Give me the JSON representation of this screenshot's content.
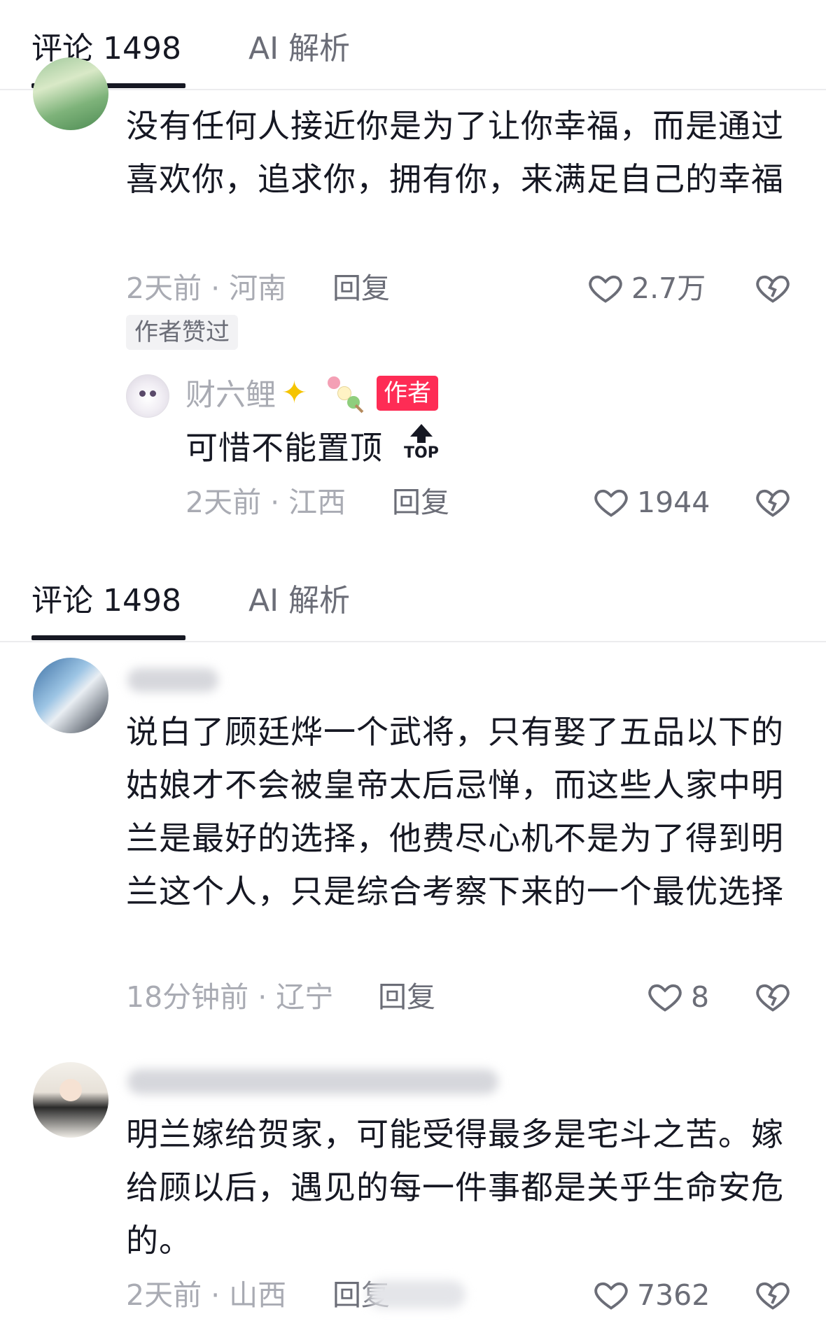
{
  "tabs": {
    "comments_label": "评论 1498",
    "ai_label": "AI 解析"
  },
  "comment1": {
    "text": "没有任何人接近你是为了让你幸福，而是通过喜欢你，追求你，拥有你，来满足自己的幸福",
    "meta": "2天前 · 河南",
    "reply_label": "回复",
    "likes": "2.7万",
    "author_liked": "作者赞过"
  },
  "reply1": {
    "username": "财六鲤",
    "badge": "作者",
    "text": "可惜不能置顶",
    "top_label": "TOP",
    "meta": "2天前 · 江西",
    "reply_label": "回复",
    "likes": "1944"
  },
  "comment2": {
    "text": "说白了顾廷烨一个武将，只有娶了五品以下的姑娘才不会被皇帝太后忌惮，而这些人家中明兰是最好的选择，他费尽心机不是为了得到明兰这个人，只是综合考察下来的一个最优选择",
    "meta": "18分钟前 · 辽宁",
    "reply_label": "回复",
    "likes": "8"
  },
  "comment3": {
    "text": "明兰嫁给贺家，可能受得最多是宅斗之苦。嫁给顾以后，遇见的每一件事都是关乎生命安危的。",
    "meta": "2天前 · 山西",
    "reply_label": "回复",
    "likes": "7362"
  },
  "colors": {
    "accent": "#fe2c55",
    "text": "#161823",
    "muted": "#a9abb3"
  }
}
